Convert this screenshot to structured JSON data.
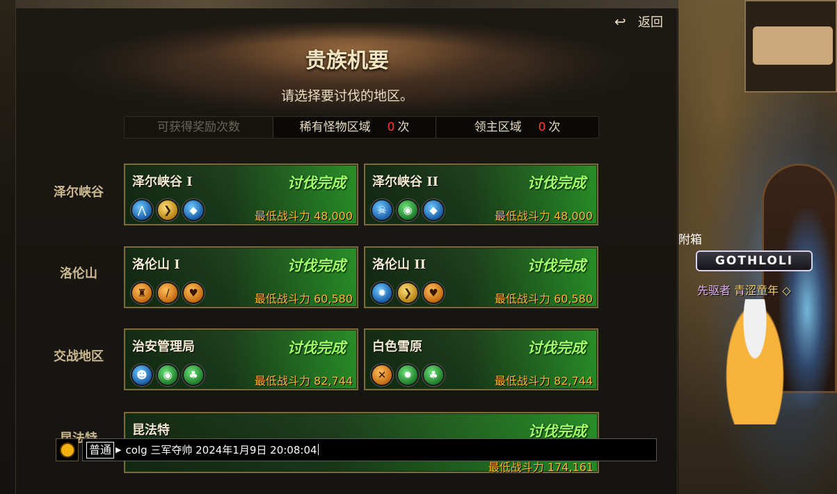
{
  "panel": {
    "back_label": "返回",
    "title": "贵族机要",
    "subtitle": "请选择要讨伐的地区。"
  },
  "rewards": {
    "header": "可获得奖励次数",
    "rare": {
      "label": "稀有怪物区域",
      "count": "0",
      "unit": "次"
    },
    "lord": {
      "label": "领主区域",
      "count": "0",
      "unit": "次"
    }
  },
  "regions": [
    {
      "name": "泽尔峡谷",
      "cards": [
        {
          "name": "泽尔峡谷 I",
          "status": "讨伐完成",
          "power": "最低战斗力 48,000",
          "icons": [
            "blue-beast-icon",
            "gold-claw-icon",
            "blue-crystal-icon"
          ]
        },
        {
          "name": "泽尔峡谷 II",
          "status": "讨伐完成",
          "power": "最低战斗力 48,000",
          "icons": [
            "blue-skull-icon",
            "green-eye-icon",
            "blue-crystal-icon"
          ]
        }
      ]
    },
    {
      "name": "洛伦山",
      "cards": [
        {
          "name": "洛伦山 I",
          "status": "讨伐完成",
          "power": "最低战斗力 60,580",
          "icons": [
            "orange-totem-icon",
            "orange-feather-icon",
            "orange-heart-icon"
          ]
        },
        {
          "name": "洛伦山 II",
          "status": "讨伐完成",
          "power": "最低战斗力 60,580",
          "icons": [
            "blue-gear-icon",
            "gold-claw-icon",
            "orange-heart-icon"
          ]
        }
      ]
    },
    {
      "name": "交战地区",
      "cards": [
        {
          "name": "治安管理局",
          "status": "讨伐完成",
          "power": "最低战斗力 82,744",
          "icons": [
            "blue-mask-icon",
            "green-eye-icon",
            "green-clover-icon"
          ]
        },
        {
          "name": "白色雪原",
          "status": "讨伐完成",
          "power": "最低战斗力 82,744",
          "icons": [
            "orange-swords-icon",
            "green-gear-icon",
            "green-clover-icon"
          ]
        }
      ]
    },
    {
      "name": "昆法特",
      "cards": [
        {
          "name": "昆法特",
          "status": "讨伐完成",
          "power": "最低战斗力 174,161",
          "icons": []
        }
      ]
    }
  ],
  "chat": {
    "mode": "普通",
    "text": "colg 三军夺帅 2024年1月9日 20:08:04"
  },
  "scene": {
    "side_label": "附箱",
    "nameplate": "GOTHLOLI",
    "title_prefix": "先驱者",
    "character_name": "青涩童年"
  }
}
